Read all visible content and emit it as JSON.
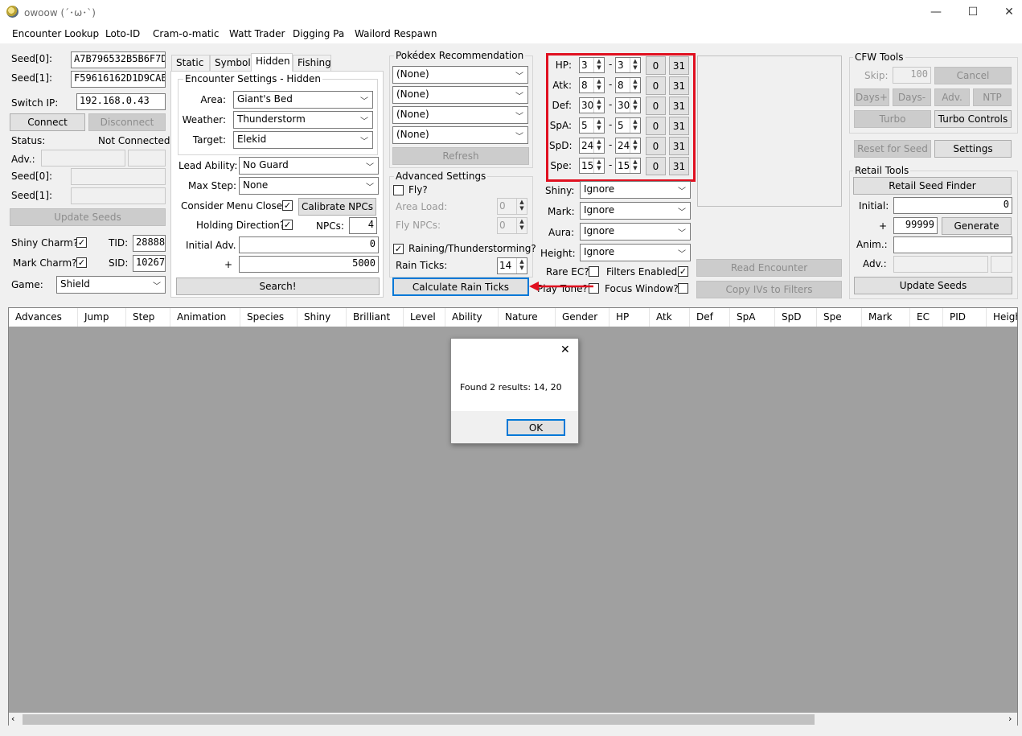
{
  "window": {
    "title": "owoow (´･ω･`)",
    "minimize": "—",
    "maximize": "☐",
    "close": "✕"
  },
  "menu": [
    "Encounter Lookup",
    "Loto-ID",
    "Cram-o-matic",
    "Watt Trader",
    "Digging Pa",
    "Wailord Respawn"
  ],
  "connection": {
    "seed0_label": "Seed[0]:",
    "seed0": "A7B796532B5B6F7D",
    "seed1_label": "Seed[1]:",
    "seed1": "F59616162D1D9CAE",
    "switch_ip_label": "Switch IP:",
    "switch_ip": "192.168.0.43",
    "connect": "Connect",
    "disconnect": "Disconnect",
    "status_label": "Status:",
    "status": "Not Connected.",
    "adv_label": "Adv.:",
    "s0_label": "Seed[0]:",
    "s1_label": "Seed[1]:",
    "update_seeds": "Update Seeds",
    "shiny_charm": "Shiny Charm?",
    "tid_label": "TID:",
    "tid": "28888",
    "mark_charm": "Mark Charm?",
    "sid_label": "SID:",
    "sid": "10267",
    "game_label": "Game:",
    "game": "Shield"
  },
  "tabs": [
    "Static",
    "Symbol",
    "Hidden",
    "Fishing"
  ],
  "hidden": {
    "group": "Encounter Settings - Hidden",
    "area_label": "Area:",
    "area": "Giant's Bed",
    "weather_label": "Weather:",
    "weather": "Thunderstorm",
    "target_label": "Target:",
    "target": "Elekid",
    "lead_label": "Lead Ability:",
    "lead": "No Guard",
    "maxstep_label": "Max Step:",
    "maxstep": "None",
    "menu_close": "Consider Menu Close?",
    "calibrate": "Calibrate NPCs",
    "holding": "Holding Direction?",
    "npcs_label": "NPCs:",
    "npcs": "4",
    "initial_label": "Initial Adv.",
    "initial": "0",
    "plus": "+",
    "range": "5000",
    "search": "Search!"
  },
  "pokedex": {
    "title": "Pokédex Recommendation",
    "options": [
      "(None)",
      "(None)",
      "(None)",
      "(None)"
    ],
    "refresh": "Refresh"
  },
  "advanced": {
    "title": "Advanced Settings",
    "fly": "Fly?",
    "area_load": "Area Load:",
    "area_load_val": "0",
    "fly_npcs": "Fly NPCs:",
    "fly_npcs_val": "0",
    "raining": "Raining/Thunderstorming?",
    "rain_ticks_label": "Rain Ticks:",
    "rain_ticks": "14",
    "calc": "Calculate Rain Ticks"
  },
  "ivs": [
    {
      "label": "HP:",
      "min": "3",
      "max": "3"
    },
    {
      "label": "Atk:",
      "min": "8",
      "max": "8"
    },
    {
      "label": "Def:",
      "min": "30",
      "max": "30"
    },
    {
      "label": "SpA:",
      "min": "5",
      "max": "5"
    },
    {
      "label": "SpD:",
      "min": "24",
      "max": "24"
    },
    {
      "label": "Spe:",
      "min": "15",
      "max": "15"
    }
  ],
  "iv_zero": "0",
  "iv_max": "31",
  "dash": "-",
  "filters": {
    "shiny_label": "Shiny:",
    "shiny": "Ignore",
    "mark_label": "Mark:",
    "mark": "Ignore",
    "aura_label": "Aura:",
    "aura": "Ignore",
    "height_label": "Height:",
    "height": "Ignore",
    "rare_ec": "Rare EC?",
    "filters_enabled": "Filters Enabled?",
    "play_tone": "Play Tone?",
    "focus_window": "Focus Window?"
  },
  "encounter_buttons": {
    "read": "Read Encounter",
    "copy": "Copy IVs to Filters"
  },
  "cfw": {
    "title": "CFW Tools",
    "skip_label": "Skip:",
    "skip": "100",
    "cancel": "Cancel",
    "days_plus": "Days+",
    "days_minus": "Days-",
    "adv": "Adv.",
    "ntp": "NTP",
    "turbo": "Turbo",
    "turbo_controls": "Turbo Controls",
    "reset_for_seed": "Reset for Seed",
    "settings": "Settings"
  },
  "retail": {
    "title": "Retail Tools",
    "finder": "Retail Seed Finder",
    "initial_label": "Initial:",
    "initial": "0",
    "plus": "+",
    "range": "99999",
    "generate": "Generate",
    "anim_label": "Anim.:",
    "adv_label": "Adv.:",
    "update": "Update Seeds"
  },
  "columns": [
    "Advances",
    "Jump",
    "Step",
    "Animation",
    "Species",
    "Shiny",
    "Brilliant",
    "Level",
    "Ability",
    "Nature",
    "Gender",
    "HP",
    "Atk",
    "Def",
    "SpA",
    "SpD",
    "Spe",
    "Mark",
    "EC",
    "PID",
    "Heigh"
  ],
  "dialog": {
    "message": "Found 2 results: 14, 20",
    "ok": "OK",
    "close": "✕"
  },
  "accent_colors": {
    "highlight": "#e01020",
    "focus": "#0078d7"
  }
}
